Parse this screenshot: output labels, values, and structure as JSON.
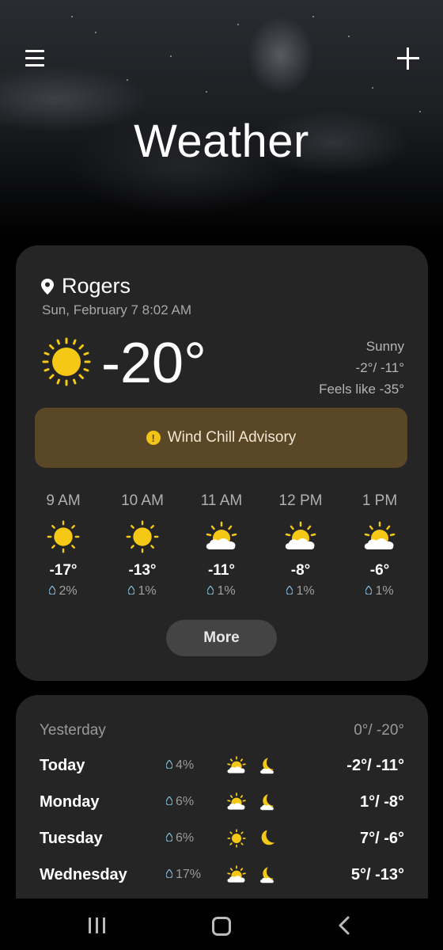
{
  "app": {
    "title": "Weather"
  },
  "header": {
    "menu_icon": "menu-icon",
    "add_icon": "plus-icon"
  },
  "current": {
    "location": "Rogers",
    "datetime": "Sun, February 7 8:02 AM",
    "temperature": "-20°",
    "condition": "Sunny",
    "hi_lo": "-2°/ -11°",
    "feels_like": "Feels like -35°",
    "icon": "sun-icon"
  },
  "advisory": {
    "label": "Wind Chill Advisory",
    "icon": "alert-icon",
    "color": "#5a4725"
  },
  "hourly": [
    {
      "time": "9 AM",
      "icon": "sun-icon",
      "temp": "-17°",
      "precip": "2%"
    },
    {
      "time": "10 AM",
      "icon": "sun-icon",
      "temp": "-13°",
      "precip": "1%"
    },
    {
      "time": "11 AM",
      "icon": "sun-cloud-icon",
      "temp": "-11°",
      "precip": "1%"
    },
    {
      "time": "12 PM",
      "icon": "sun-cloud-icon",
      "temp": "-8°",
      "precip": "1%"
    },
    {
      "time": "1 PM",
      "icon": "sun-cloud-icon",
      "temp": "-6°",
      "precip": "1%"
    }
  ],
  "more_label": "More",
  "daily": {
    "yesterday": {
      "label": "Yesterday",
      "temps": "0°/ -20°"
    },
    "days": [
      {
        "day": "Today",
        "precip": "4%",
        "day_icon": "sun-cloud-icon",
        "night_icon": "moon-cloud-icon",
        "temps": "-2°/ -11°"
      },
      {
        "day": "Monday",
        "precip": "6%",
        "day_icon": "sun-cloud-icon",
        "night_icon": "moon-cloud-icon",
        "temps": "1°/ -8°"
      },
      {
        "day": "Tuesday",
        "precip": "6%",
        "day_icon": "sun-icon",
        "night_icon": "moon-icon",
        "temps": "7°/ -6°"
      },
      {
        "day": "Wednesday",
        "precip": "17%",
        "day_icon": "sun-cloud-icon",
        "night_icon": "moon-cloud-icon",
        "temps": "5°/ -13°"
      }
    ]
  },
  "colors": {
    "sun": "#f5c816",
    "card": "#252525",
    "background": "#000000"
  }
}
